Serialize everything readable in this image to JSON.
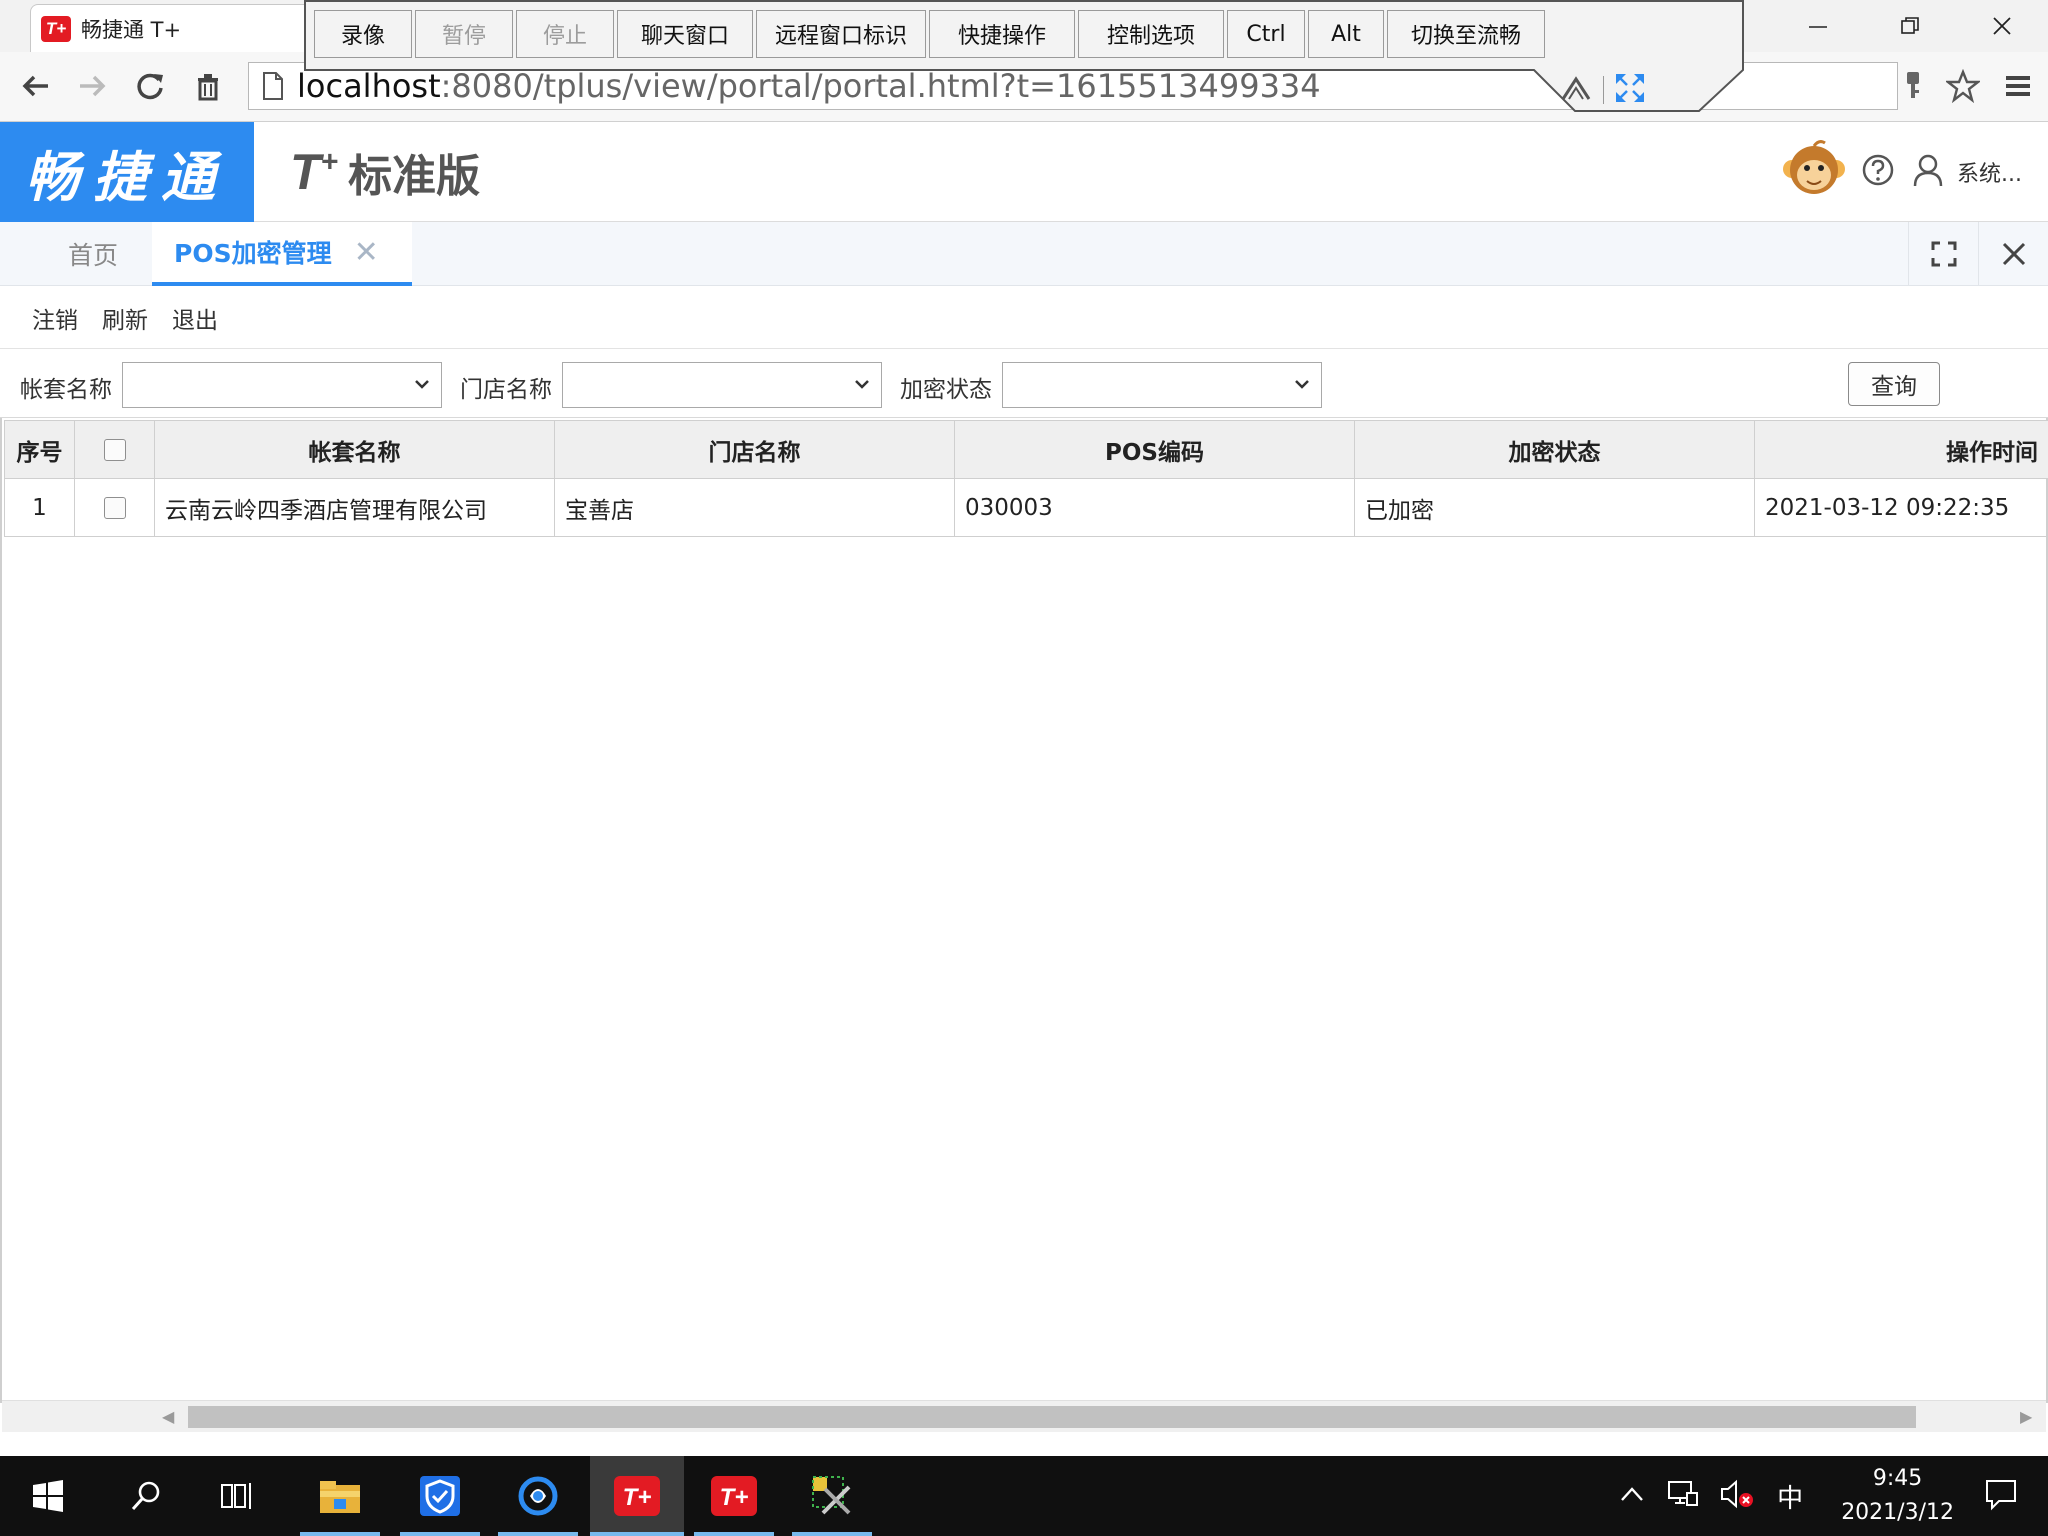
{
  "browser": {
    "tab_title": "畅捷通 T+",
    "tab_favicon_text": "T+",
    "url_host": "localhost",
    "url_rest": ":8080/tplus/view/portal/portal.html?t=1615513499334"
  },
  "remote_toolbar": {
    "buttons": [
      {
        "label": "录像",
        "enabled": true,
        "width": 98
      },
      {
        "label": "暂停",
        "enabled": false,
        "width": 98
      },
      {
        "label": "停止",
        "enabled": false,
        "width": 98
      },
      {
        "label": "聊天窗口",
        "enabled": true,
        "width": 136
      },
      {
        "label": "远程窗口标识",
        "enabled": true,
        "width": 170
      },
      {
        "label": "快捷操作",
        "enabled": true,
        "width": 146
      },
      {
        "label": "控制选项",
        "enabled": true,
        "width": 146
      },
      {
        "label": "Ctrl",
        "enabled": true,
        "width": 78
      },
      {
        "label": "Alt",
        "enabled": true,
        "width": 76
      },
      {
        "label": "切换至流畅",
        "enabled": true,
        "width": 158
      }
    ]
  },
  "app": {
    "brand": "畅捷通",
    "product": "T",
    "product_sup": "+",
    "edition": "标准版",
    "user_label": "系统..."
  },
  "tabs": {
    "home": "首页",
    "active": "POS加密管理",
    "close_glyph": "✕"
  },
  "toolbar": {
    "items": [
      "注销",
      "刷新",
      "退出"
    ]
  },
  "filters": {
    "account_label": "帐套名称",
    "store_label": "门店名称",
    "status_label": "加密状态",
    "account_value": "",
    "store_value": "",
    "status_value": "",
    "query_label": "查询"
  },
  "grid": {
    "columns": {
      "index": "序号",
      "account": "帐套名称",
      "store": "门店名称",
      "pos_code": "POS编码",
      "status": "加密状态",
      "time": "操作时间"
    },
    "rows": [
      {
        "index": "1",
        "account": "云南云岭四季酒店管理有限公司",
        "store": "宝善店",
        "pos_code": "030003",
        "status": "已加密",
        "time": "2021-03-12 09:22:35"
      }
    ]
  },
  "taskbar": {
    "time": "9:45",
    "date": "2021/3/12",
    "ime": "中"
  },
  "colors": {
    "brand_blue": "#2d8bf0",
    "tplus_red": "#e31b23"
  }
}
